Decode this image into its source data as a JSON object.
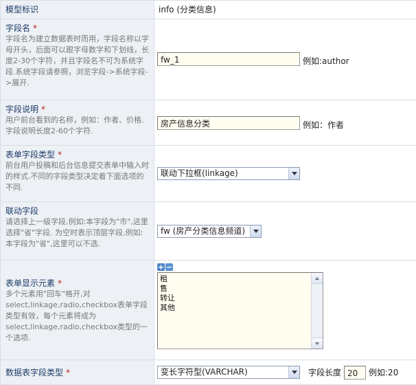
{
  "rows": {
    "model_id": {
      "label": "模型标识",
      "value": "info (分类信息)"
    },
    "field_name": {
      "label": "字段名",
      "required_mark": "*",
      "desc": "字段名为建立数据表时而用，字段名称以字母开头，后面可以跟字母数字和下划线，长度2-30个字符，并且字段名不可为系统字段.系统字段请参照，浏览字段->系统字段->展开.",
      "value": "fw_1",
      "hint": "例如:author"
    },
    "field_desc": {
      "label": "字段说明",
      "required_mark": "*",
      "desc": "用户前台看到的名称，例如：作者、价格.字段说明长度2-60个字符.",
      "value": "房产信息分类",
      "hint": "例如：作者"
    },
    "form_type": {
      "label": "表单字段类型",
      "required_mark": "*",
      "desc": "前台用户投稿和后台信息提交表单中输入时的样式.不同的字段类型决定着下面选项的不同.",
      "selected": "联动下拉框(linkage)"
    },
    "linked_field": {
      "label": "联动字段",
      "desc": "请选择上一级字段,例如:本字段为\"市\",这里选择\"省\"字段. 为空时表示顶层字段,例如:本字段为\"省\",这里可以不选.",
      "selected": "fw (房产分类信息频道)"
    },
    "display_elements": {
      "label": "表单显示元素",
      "required_mark": "*",
      "desc": "多个元素用\"回车\"格开,对select,linkage,radio,checkbox表单字段类型有效，每个元素将成为select,linkage,radio,checkbox类型的一个选项.",
      "plus_icon": "+",
      "minus_icon": "−",
      "value": "租\n售\n转让\n其他"
    },
    "db_type": {
      "label": "数据表字段类型",
      "required_mark": "*",
      "selected": "变长字符型(VARCHAR)",
      "length_label": "字段长度",
      "length_value": "20",
      "hint": "例如:20"
    }
  }
}
